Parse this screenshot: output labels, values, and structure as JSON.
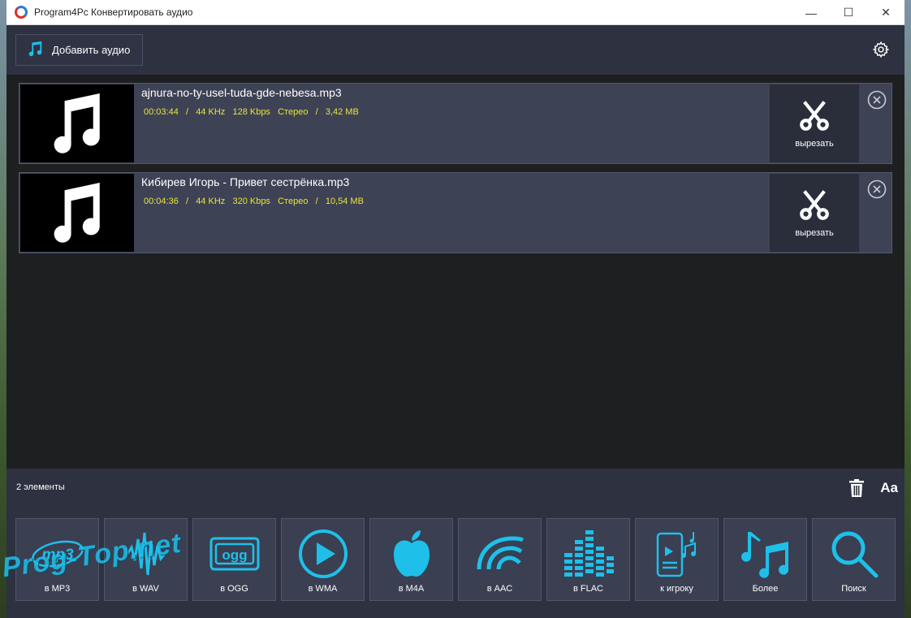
{
  "window": {
    "title": "Program4Pc Конвертировать аудио",
    "controls": {
      "minimize": "—",
      "maximize": "☐",
      "close": "✕"
    }
  },
  "toolbar": {
    "add_audio_label": "Добавить аудио",
    "settings_icon": "gear-icon"
  },
  "files": [
    {
      "name": "ajnura-no-ty-usel-tuda-gde-nebesa.mp3",
      "duration": "00:03:44",
      "sample_rate": "44 KHz",
      "bitrate": "128 Kbps",
      "channels": "Стерео",
      "size": "3,42 MB",
      "meta": "00:03:44   /   44 KHz   128 Kbps   Стерео   /   3,42 MB",
      "cut_label": "вырезать"
    },
    {
      "name": "Кибирев Игорь - Привет сестрёнка.mp3",
      "duration": "00:04:36",
      "sample_rate": "44 KHz",
      "bitrate": "320 Kbps",
      "channels": "Стерео",
      "size": "10,54 MB",
      "meta": "00:04:36   /   44 KHz   320 Kbps   Стерео   /   10,54 MB",
      "cut_label": "вырезать"
    }
  ],
  "status": {
    "count_text": "2  элементы",
    "font_label": "Aa"
  },
  "formats": [
    {
      "label": "в MP3",
      "icon": "mp3-icon"
    },
    {
      "label": "в WAV",
      "icon": "waveform-icon"
    },
    {
      "label": "в OGG",
      "icon": "ogg-icon"
    },
    {
      "label": "в WMA",
      "icon": "play-circle-icon"
    },
    {
      "label": "в M4A",
      "icon": "apple-icon"
    },
    {
      "label": "в AAC",
      "icon": "aac-icon"
    },
    {
      "label": "в FLAC",
      "icon": "equalizer-icon"
    },
    {
      "label": "к игроку",
      "icon": "phone-music-icon"
    },
    {
      "label": "Более",
      "icon": "music-notes-icon"
    },
    {
      "label": "Поиск",
      "icon": "search-icon"
    }
  ],
  "watermark": "Prog-Top.net",
  "colors": {
    "accent": "#1ec0ea",
    "meta_text": "#e8e53a",
    "panel": "#2d3140",
    "item_bg": "#3d4255"
  }
}
